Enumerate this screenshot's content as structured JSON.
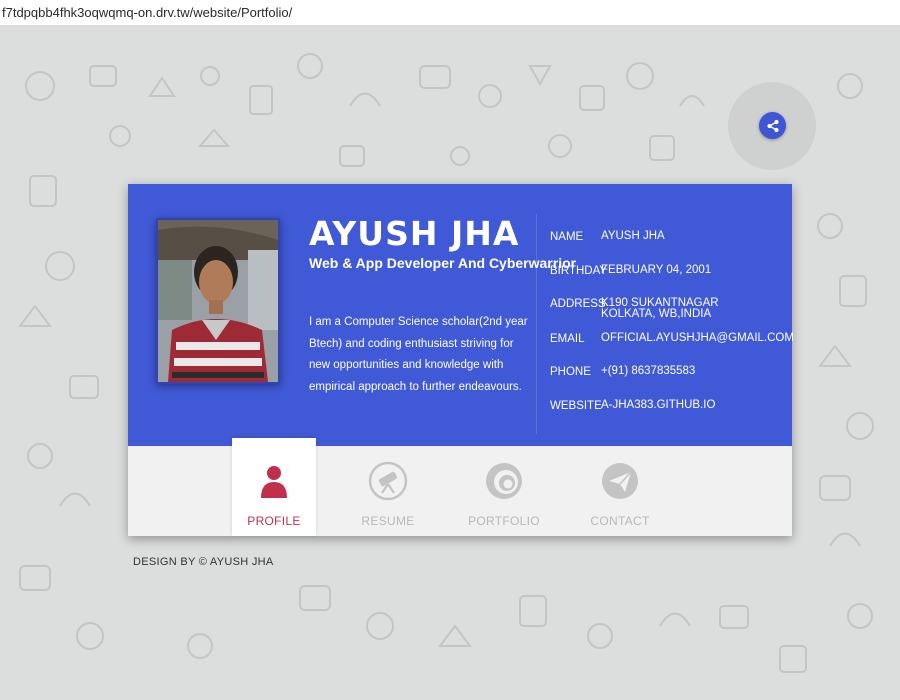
{
  "browser": {
    "url": "f7tdpqbb4fhk3oqwqmq-on.drv.tw/website/Portfolio/"
  },
  "profile": {
    "name": "AYUSH JHA",
    "tagline": "Web & App Developer And Cyberwarrior",
    "bio": "I am a Computer Science scholar(2nd year Btech) and coding enthusiast striving for new opportunities and knowledge with empirical approach to further endeavours."
  },
  "info": {
    "name_label": "NAME",
    "name_value": "AYUSH JHA",
    "birthday_label": "BIRTHDAY",
    "birthday_value": "FEBRUARY 04, 2001",
    "address_label": "ADDRESS",
    "address_value": "K190 SUKANTNAGAR KOLKATA, WB,INDIA",
    "email_label": "EMAIL",
    "email_value": "OFFICIAL.AYUSHJHA@GMAIL.COM",
    "phone_label": "PHONE",
    "phone_value": "+(91) 8637835583",
    "website_label": "WEBSITE",
    "website_value": "A-JHA383.GITHUB.IO"
  },
  "tabs": {
    "profile": "PROFILE",
    "resume": "RESUME",
    "portfolio": "PORTFOLIO",
    "contact": "CONTACT"
  },
  "footer": {
    "text": "DESIGN BY © AYUSH JHA"
  },
  "colors": {
    "accent": "#4059d6",
    "active_tab": "#c22f4d",
    "inactive_tab": "#b8b8b8"
  },
  "icons": {
    "share": "share-icon",
    "profile": "person-icon",
    "resume": "telescope-icon",
    "portfolio": "swirl-icon",
    "contact": "paper-plane-icon"
  }
}
